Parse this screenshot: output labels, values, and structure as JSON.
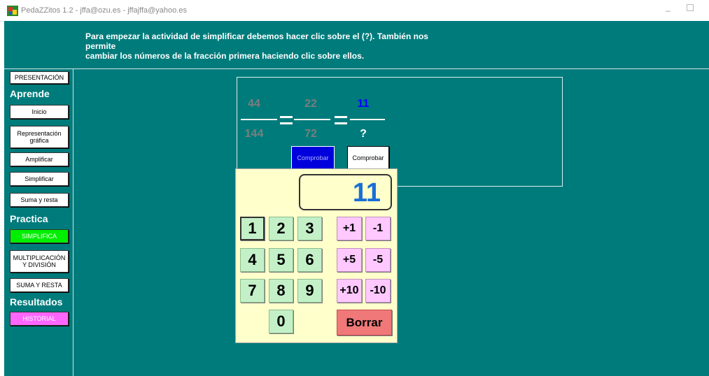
{
  "window": {
    "title": "PedaZZitos 1.2 - jffa@ozu.es - jffajffa@yahoo.es",
    "minimize_glyph": "–",
    "icon": "app-logo-icon"
  },
  "instruction": {
    "line1": "Para empezar la actividad de simplificar debemos hacer clic sobre el (?). También nos permite",
    "line2": "cambiar los números de la fracción primera haciendo clic sobre ellos."
  },
  "sidebar": {
    "presentacion": "PRESENTACIÓN",
    "aprende_heading": "Aprende",
    "aprende_items": [
      "Inicio",
      "Representación gráfica",
      "Amplificar",
      "Simplificar",
      "Suma y resta"
    ],
    "practica_heading": "Practica",
    "practica_items": [
      "SIMPLIFICA",
      "MULTIPLICACIÓN Y DIVISIÓN",
      "SUMA Y RESTA"
    ],
    "resultados_heading": "Resultados",
    "resultados_items": [
      "HISTORIAL"
    ]
  },
  "fractions": {
    "f1": {
      "num": "44",
      "den": "144"
    },
    "f2": {
      "num": "22",
      "den": "72"
    },
    "f3": {
      "num": "11",
      "den": "?"
    }
  },
  "buttons": {
    "comprobar_blue": "Comprobar",
    "comprobar_white": "Comprobar"
  },
  "keypad": {
    "display": "11",
    "digits": [
      "1",
      "2",
      "3",
      "4",
      "5",
      "6",
      "7",
      "8",
      "9",
      "0"
    ],
    "adjust": [
      "+1",
      "-1",
      "+5",
      "-5",
      "+10",
      "-10"
    ],
    "clear": "Borrar"
  },
  "colors": {
    "background": "#007b7b",
    "display_number": "#1a6fd6",
    "answer_numerator": "#0000ff"
  }
}
